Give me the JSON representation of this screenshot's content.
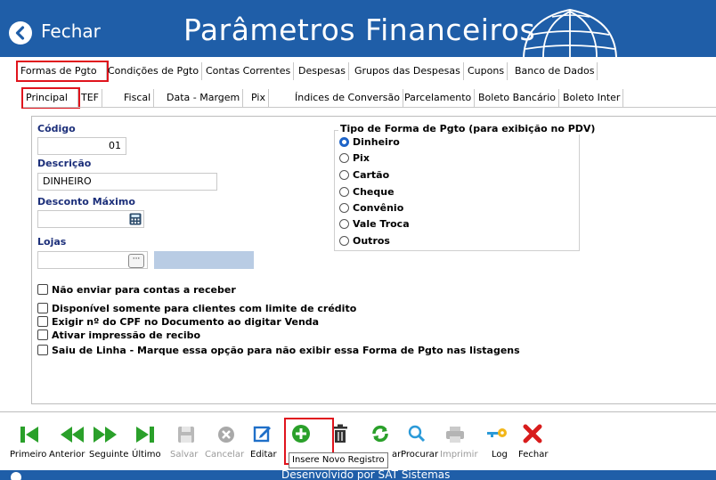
{
  "header": {
    "back_label": "Fechar",
    "title": "Parâmetros Financeiros",
    "bg_color": "#1f5ea8"
  },
  "tabs_main": [
    "Formas de Pgto",
    "Condições de Pgto",
    "Contas Correntes",
    "Despesas",
    "Grupos das Despesas",
    "Cupons",
    "Banco de Dados"
  ],
  "tabs_sub": [
    "Principal",
    "TEF",
    "Fiscal",
    "Data - Margem",
    "Pix",
    "Índices de Conversão",
    "Parcelamento",
    "Boleto Bancário",
    "Boleto Inter"
  ],
  "form": {
    "codigo_label": "Código",
    "codigo_value": "01",
    "descricao_label": "Descrição",
    "descricao_value": "DINHEIRO",
    "desconto_label": "Desconto Máximo",
    "desconto_value": "",
    "lojas_label": "Lojas",
    "lojas_value": "",
    "lojas_button": "···"
  },
  "tipo_group": {
    "title": "Tipo de Forma de Pgto (para exibição no PDV)",
    "options": [
      "Dinheiro",
      "Pix",
      "Cartão",
      "Cheque",
      "Convênio",
      "Vale Troca",
      "Outros"
    ],
    "selected": "Dinheiro"
  },
  "checkboxes": [
    "Não enviar para contas a receber",
    "Disponível somente para clientes com limite de crédito",
    "Exigir nº do CPF no Documento ao digitar Venda",
    "Ativar impressão de recibo",
    "Saiu de Linha - Marque essa opção para não exibir essa Forma de Pgto nas listagens"
  ],
  "toolbar": {
    "primeiro": "Primeiro",
    "anterior": "Anterior",
    "seguinte": "Seguinte",
    "ultimo": "Último",
    "salvar": "Salvar",
    "cancelar": "Cancelar",
    "editar": "Editar",
    "atualizar_partial": "ar",
    "procurar": "Procurar",
    "imprimir": "Imprimir",
    "log": "Log",
    "fechar": "Fechar"
  },
  "tooltip": "Insere Novo Registro",
  "footer": "Desenvolvido por SAT Sistemas",
  "colors": {
    "accent": "#1f5ea8",
    "nav_green": "#2aa02a",
    "highlight_red": "#e0141d",
    "label_blue": "#1c2f7a"
  },
  "icons": {
    "back": "chevron-left-circle-icon",
    "globe": "globe-icon",
    "first": "skip-first-icon",
    "prev": "rewind-icon",
    "next": "fast-forward-icon",
    "last": "skip-last-icon",
    "save": "save-icon",
    "cancel": "cancel-icon",
    "edit": "edit-icon",
    "add": "plus-circle-icon",
    "delete": "trash-icon",
    "refresh": "refresh-icon",
    "search": "search-icon",
    "print": "printer-icon",
    "log": "key-icon",
    "close": "close-x-icon"
  }
}
